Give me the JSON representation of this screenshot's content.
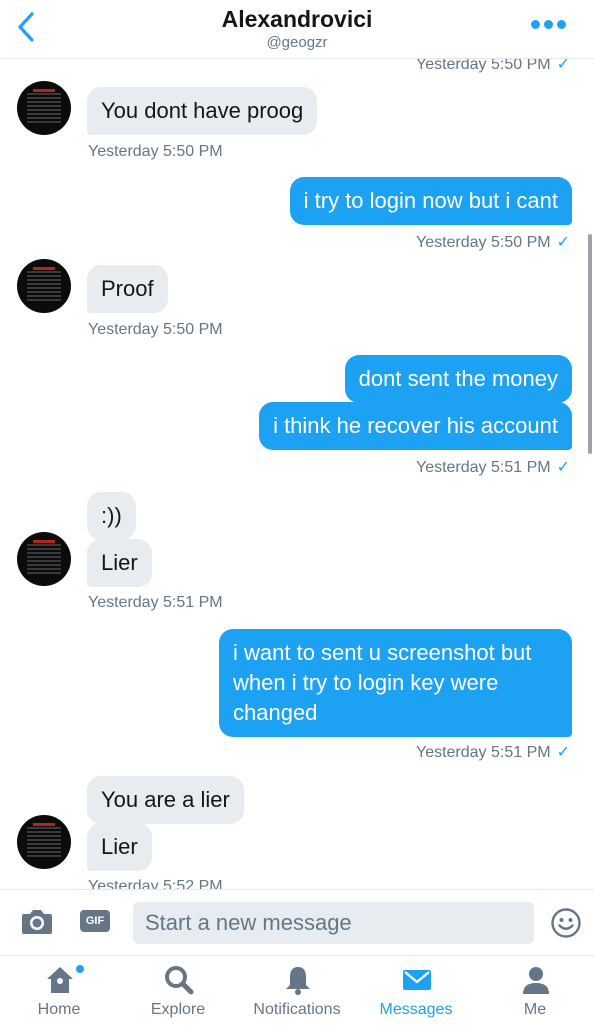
{
  "header": {
    "title": "Alexandrovici",
    "handle": "@geogzr"
  },
  "messages": [
    {
      "id": "m0",
      "dir": "out",
      "text": "",
      "time": "Yesterday 5:50 PM"
    },
    {
      "id": "m1",
      "dir": "in",
      "text": "You dont have proog",
      "time": "Yesterday 5:50 PM"
    },
    {
      "id": "m2",
      "dir": "out",
      "text": "i try to login now but i cant",
      "time": "Yesterday 5:50 PM"
    },
    {
      "id": "m3",
      "dir": "in",
      "text": "Proof",
      "time": "Yesterday 5:50 PM"
    },
    {
      "id": "m4",
      "dir": "out",
      "text": "dont sent the money"
    },
    {
      "id": "m5",
      "dir": "out",
      "text": "i think he recover his account",
      "time": "Yesterday 5:51 PM"
    },
    {
      "id": "m6",
      "dir": "in",
      "text": ":))"
    },
    {
      "id": "m7",
      "dir": "in",
      "text": "Lier",
      "time": "Yesterday 5:51 PM"
    },
    {
      "id": "m8",
      "dir": "out",
      "lines": [
        "i want to sent u screenshot but",
        "when i try to login key were",
        "changed"
      ],
      "time": "Yesterday 5:51 PM"
    },
    {
      "id": "m9",
      "dir": "in",
      "text": "You are a lier"
    },
    {
      "id": "m10",
      "dir": "in",
      "text": "Lier",
      "time": "Yesterday 5:52 PM"
    }
  ],
  "read_mark": "✓",
  "composer": {
    "placeholder": "Start a new message",
    "gif_label": "GIF"
  },
  "tabs": [
    {
      "label": "Home",
      "icon": "home-icon"
    },
    {
      "label": "Explore",
      "icon": "search-icon"
    },
    {
      "label": "Notifications",
      "icon": "bell-icon"
    },
    {
      "label": "Messages",
      "icon": "envelope-icon",
      "active": true
    },
    {
      "label": "Me",
      "icon": "person-icon"
    }
  ],
  "colors": {
    "accent": "#1da1f2",
    "incoming_bubble": "#e6ecf0",
    "muted": "#657786"
  }
}
